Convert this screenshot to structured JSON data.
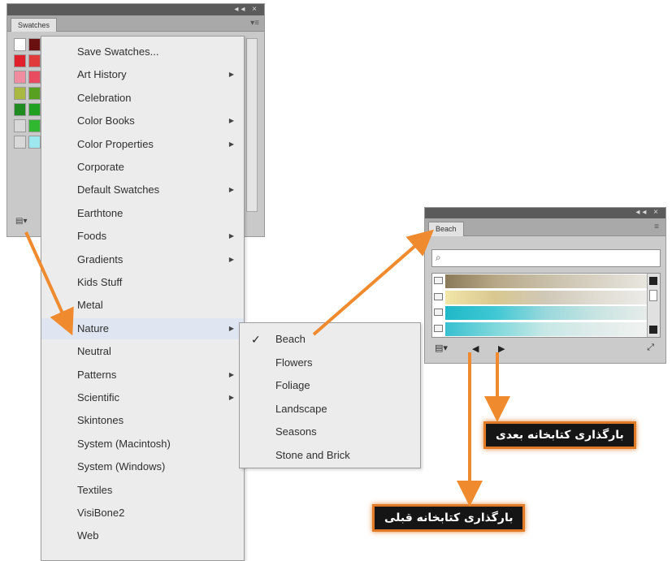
{
  "swatches_panel": {
    "tab_label": "Swatches",
    "win_icons": "◂◂ ×",
    "panel_menu_icon": "▾≡",
    "lib_button": "▤▾",
    "swatches": [
      [
        "#ffffff",
        "#6a1010"
      ],
      [
        "#e0202a",
        "#e03a3a"
      ],
      [
        "#f08ca0",
        "#e84a60"
      ],
      [
        "#a8b840",
        "#58a020"
      ],
      [
        "#1f8a1f",
        "#20a020"
      ],
      [
        "#d8d8d8",
        "#30b830"
      ],
      [
        "#d8d8d8",
        "#9de8ee"
      ]
    ]
  },
  "menu": {
    "items": [
      {
        "label": "Save Swatches...",
        "arrow": false
      },
      {
        "label": "Art History",
        "arrow": true
      },
      {
        "label": "Celebration",
        "arrow": false
      },
      {
        "label": "Color Books",
        "arrow": true
      },
      {
        "label": "Color Properties",
        "arrow": true
      },
      {
        "label": "Corporate",
        "arrow": false
      },
      {
        "label": "Default Swatches",
        "arrow": true
      },
      {
        "label": "Earthtone",
        "arrow": false
      },
      {
        "label": "Foods",
        "arrow": true
      },
      {
        "label": "Gradients",
        "arrow": true
      },
      {
        "label": "Kids Stuff",
        "arrow": false
      },
      {
        "label": "Metal",
        "arrow": false
      },
      {
        "label": "Nature",
        "arrow": true
      },
      {
        "label": "Neutral",
        "arrow": false
      },
      {
        "label": "Patterns",
        "arrow": true
      },
      {
        "label": "Scientific",
        "arrow": true
      },
      {
        "label": "Skintones",
        "arrow": false
      },
      {
        "label": "System (Macintosh)",
        "arrow": false
      },
      {
        "label": "System (Windows)",
        "arrow": false
      },
      {
        "label": "Textiles",
        "arrow": false
      },
      {
        "label": "VisiBone2",
        "arrow": false
      },
      {
        "label": "Web",
        "arrow": false
      }
    ],
    "arrow_glyph": "▶"
  },
  "submenu": {
    "check_glyph": "✓",
    "items": [
      {
        "label": "Beach",
        "checked": true
      },
      {
        "label": "Flowers",
        "checked": false
      },
      {
        "label": "Foliage",
        "checked": false
      },
      {
        "label": "Landscape",
        "checked": false
      },
      {
        "label": "Seasons",
        "checked": false
      },
      {
        "label": "Stone and Brick",
        "checked": false
      }
    ]
  },
  "beach_panel": {
    "tab_label": "Beach",
    "win_icons": "◂◂ ×",
    "panel_menu_icon": "≡",
    "search_icon": "⌕",
    "search_value": "",
    "rows": [
      {
        "colors": [
          "#8a7a5a",
          "#b8a888",
          "#c8bfa8",
          "#d8d2c4",
          "#e8e6e0"
        ]
      },
      {
        "colors": [
          "#f2e6a8",
          "#d8c890",
          "#d0c8b8",
          "#e0dcd2",
          "#ecebe8"
        ]
      },
      {
        "colors": [
          "#20b8c8",
          "#40c8d4",
          "#9ad8dc",
          "#c8e4e2",
          "#e6ecea"
        ]
      },
      {
        "colors": [
          "#38c0d0",
          "#80d8dc",
          "#c8e8e6",
          "#e0ecea",
          "#f0f2f0"
        ]
      }
    ],
    "lib_button": "▤▾",
    "prev_button": "◀",
    "next_button": "▶",
    "link_button": "⤢"
  },
  "callouts": {
    "next": "بارگذاری کتابخانه بعدی",
    "prev": "بارگذاری کتابخانه قبلی"
  },
  "colors": {
    "accent_arrow": "#f08a2e"
  }
}
